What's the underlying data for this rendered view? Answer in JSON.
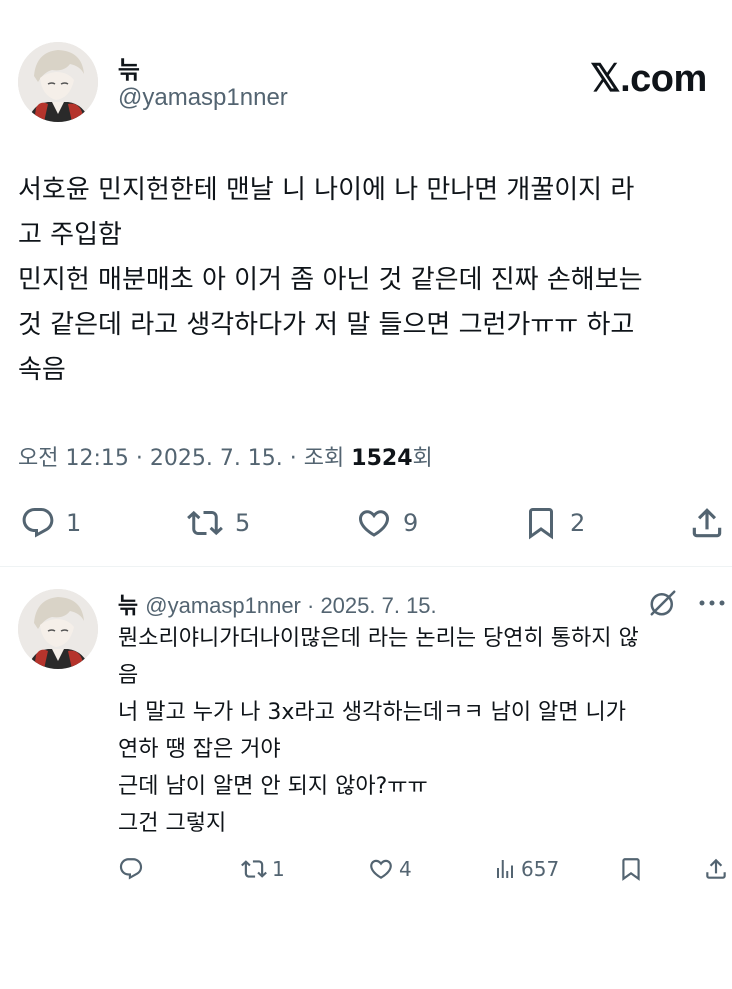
{
  "main_tweet": {
    "author_name": "늒",
    "author_handle": "@yamasp1nner",
    "site_logo": "𝕏.com",
    "body": "서호윤 민지헌한테 맨날 니 나이에 나 만나면 개꿀이지 라\n고 주입함\n민지헌 매분매초 아 이거 좀 아닌 것 같은데 진짜 손해보는\n것 같은데 라고 생각하다가 저 말 들으면 그런가ㅠㅠ 하고\n속음",
    "time": "오전 12:15 · 2025. 7. 15. · 조회 ",
    "views": "1524",
    "views_suffix": "회",
    "actions": {
      "reply": {
        "icon": "comment-icon",
        "count": "1"
      },
      "retweet": {
        "icon": "retweet-icon",
        "count": "5"
      },
      "like": {
        "icon": "heart-icon",
        "count": "9"
      },
      "bookmark": {
        "icon": "bookmark-icon",
        "count": "2"
      },
      "share": {
        "icon": "share-icon"
      }
    }
  },
  "reply_tweet": {
    "author_name": "늒",
    "author_handle": "@yamasp1nner",
    "date": " · 2025. 7. 15.",
    "body": "뭔소리야니가더나이많은데 라는 논리는 당연히 통하지 않\n음\n너 말고 누가 나 3x라고 생각하는데ㅋㅋ 남이 알면 니가\n연하 땡 잡은 거야\n근데 남이 알면 안 되지 않아?ㅠㅠ\n그건 그렇지",
    "actions": {
      "reply": {
        "icon": "comment-icon"
      },
      "retweet": {
        "icon": "retweet-icon",
        "count": "1"
      },
      "like": {
        "icon": "heart-icon",
        "count": "4"
      },
      "views": {
        "icon": "views-chart-icon",
        "count": "657"
      },
      "bookmark": {
        "icon": "bookmark-icon"
      },
      "share": {
        "icon": "share-icon"
      }
    }
  },
  "colors": {
    "text": "#0f1419",
    "secondary": "#536471",
    "divider": "#eff3f4"
  }
}
